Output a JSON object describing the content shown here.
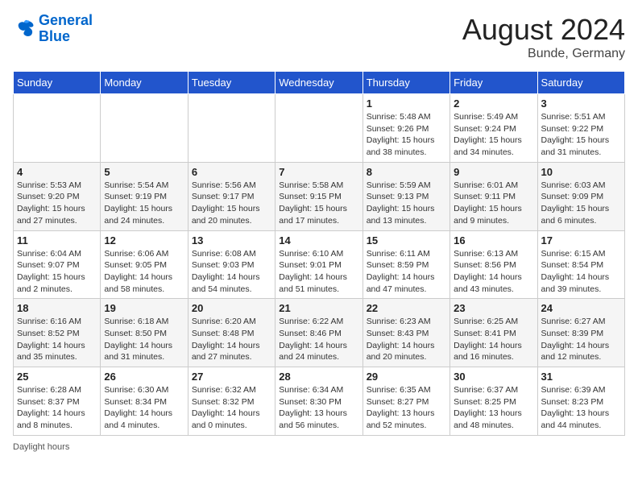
{
  "header": {
    "logo_line1": "General",
    "logo_line2": "Blue",
    "month_title": "August 2024",
    "location": "Bunde, Germany"
  },
  "days_of_week": [
    "Sunday",
    "Monday",
    "Tuesday",
    "Wednesday",
    "Thursday",
    "Friday",
    "Saturday"
  ],
  "weeks": [
    [
      {
        "day": "",
        "info": ""
      },
      {
        "day": "",
        "info": ""
      },
      {
        "day": "",
        "info": ""
      },
      {
        "day": "",
        "info": ""
      },
      {
        "day": "1",
        "info": "Sunrise: 5:48 AM\nSunset: 9:26 PM\nDaylight: 15 hours and 38 minutes."
      },
      {
        "day": "2",
        "info": "Sunrise: 5:49 AM\nSunset: 9:24 PM\nDaylight: 15 hours and 34 minutes."
      },
      {
        "day": "3",
        "info": "Sunrise: 5:51 AM\nSunset: 9:22 PM\nDaylight: 15 hours and 31 minutes."
      }
    ],
    [
      {
        "day": "4",
        "info": "Sunrise: 5:53 AM\nSunset: 9:20 PM\nDaylight: 15 hours and 27 minutes."
      },
      {
        "day": "5",
        "info": "Sunrise: 5:54 AM\nSunset: 9:19 PM\nDaylight: 15 hours and 24 minutes."
      },
      {
        "day": "6",
        "info": "Sunrise: 5:56 AM\nSunset: 9:17 PM\nDaylight: 15 hours and 20 minutes."
      },
      {
        "day": "7",
        "info": "Sunrise: 5:58 AM\nSunset: 9:15 PM\nDaylight: 15 hours and 17 minutes."
      },
      {
        "day": "8",
        "info": "Sunrise: 5:59 AM\nSunset: 9:13 PM\nDaylight: 15 hours and 13 minutes."
      },
      {
        "day": "9",
        "info": "Sunrise: 6:01 AM\nSunset: 9:11 PM\nDaylight: 15 hours and 9 minutes."
      },
      {
        "day": "10",
        "info": "Sunrise: 6:03 AM\nSunset: 9:09 PM\nDaylight: 15 hours and 6 minutes."
      }
    ],
    [
      {
        "day": "11",
        "info": "Sunrise: 6:04 AM\nSunset: 9:07 PM\nDaylight: 15 hours and 2 minutes."
      },
      {
        "day": "12",
        "info": "Sunrise: 6:06 AM\nSunset: 9:05 PM\nDaylight: 14 hours and 58 minutes."
      },
      {
        "day": "13",
        "info": "Sunrise: 6:08 AM\nSunset: 9:03 PM\nDaylight: 14 hours and 54 minutes."
      },
      {
        "day": "14",
        "info": "Sunrise: 6:10 AM\nSunset: 9:01 PM\nDaylight: 14 hours and 51 minutes."
      },
      {
        "day": "15",
        "info": "Sunrise: 6:11 AM\nSunset: 8:59 PM\nDaylight: 14 hours and 47 minutes."
      },
      {
        "day": "16",
        "info": "Sunrise: 6:13 AM\nSunset: 8:56 PM\nDaylight: 14 hours and 43 minutes."
      },
      {
        "day": "17",
        "info": "Sunrise: 6:15 AM\nSunset: 8:54 PM\nDaylight: 14 hours and 39 minutes."
      }
    ],
    [
      {
        "day": "18",
        "info": "Sunrise: 6:16 AM\nSunset: 8:52 PM\nDaylight: 14 hours and 35 minutes."
      },
      {
        "day": "19",
        "info": "Sunrise: 6:18 AM\nSunset: 8:50 PM\nDaylight: 14 hours and 31 minutes."
      },
      {
        "day": "20",
        "info": "Sunrise: 6:20 AM\nSunset: 8:48 PM\nDaylight: 14 hours and 27 minutes."
      },
      {
        "day": "21",
        "info": "Sunrise: 6:22 AM\nSunset: 8:46 PM\nDaylight: 14 hours and 24 minutes."
      },
      {
        "day": "22",
        "info": "Sunrise: 6:23 AM\nSunset: 8:43 PM\nDaylight: 14 hours and 20 minutes."
      },
      {
        "day": "23",
        "info": "Sunrise: 6:25 AM\nSunset: 8:41 PM\nDaylight: 14 hours and 16 minutes."
      },
      {
        "day": "24",
        "info": "Sunrise: 6:27 AM\nSunset: 8:39 PM\nDaylight: 14 hours and 12 minutes."
      }
    ],
    [
      {
        "day": "25",
        "info": "Sunrise: 6:28 AM\nSunset: 8:37 PM\nDaylight: 14 hours and 8 minutes."
      },
      {
        "day": "26",
        "info": "Sunrise: 6:30 AM\nSunset: 8:34 PM\nDaylight: 14 hours and 4 minutes."
      },
      {
        "day": "27",
        "info": "Sunrise: 6:32 AM\nSunset: 8:32 PM\nDaylight: 14 hours and 0 minutes."
      },
      {
        "day": "28",
        "info": "Sunrise: 6:34 AM\nSunset: 8:30 PM\nDaylight: 13 hours and 56 minutes."
      },
      {
        "day": "29",
        "info": "Sunrise: 6:35 AM\nSunset: 8:27 PM\nDaylight: 13 hours and 52 minutes."
      },
      {
        "day": "30",
        "info": "Sunrise: 6:37 AM\nSunset: 8:25 PM\nDaylight: 13 hours and 48 minutes."
      },
      {
        "day": "31",
        "info": "Sunrise: 6:39 AM\nSunset: 8:23 PM\nDaylight: 13 hours and 44 minutes."
      }
    ]
  ],
  "footer": {
    "label": "Daylight hours"
  }
}
